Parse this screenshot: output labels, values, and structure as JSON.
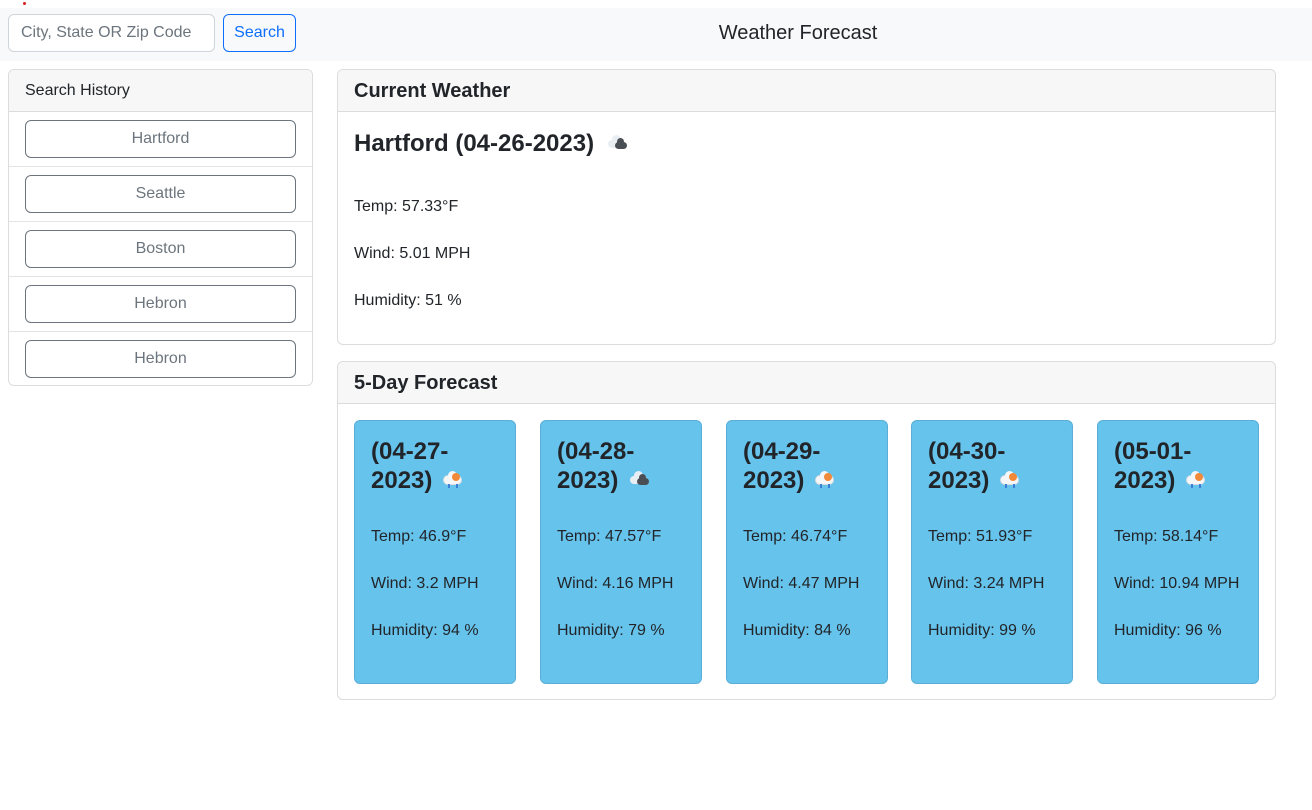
{
  "search": {
    "placeholder": "City, State OR Zip Code",
    "button_label": "Search"
  },
  "header": {
    "title": "Weather Forecast"
  },
  "history": {
    "title": "Search History",
    "items": [
      {
        "label": "Hartford"
      },
      {
        "label": "Seattle"
      },
      {
        "label": "Boston"
      },
      {
        "label": "Hebron"
      },
      {
        "label": "Hebron"
      }
    ]
  },
  "current": {
    "title": "Current Weather",
    "city_date": "Hartford (04-26-2023)",
    "icon": "broken-clouds-icon",
    "temp": "Temp: 57.33°F",
    "wind": "Wind: 5.01 MPH",
    "humidity": "Humidity: 51 %"
  },
  "forecast": {
    "title": "5-Day Forecast",
    "card_color": "#66c3ec",
    "days": [
      {
        "date": "(04-27-2023)",
        "icon": "rain-icon",
        "temp": "Temp: 46.9°F",
        "wind": "Wind: 3.2 MPH",
        "humidity": "Humidity: 94 %"
      },
      {
        "date": "(04-28-2023)",
        "icon": "broken-clouds-icon",
        "temp": "Temp: 47.57°F",
        "wind": "Wind: 4.16 MPH",
        "humidity": "Humidity: 79 %"
      },
      {
        "date": "(04-29-2023)",
        "icon": "rain-icon",
        "temp": "Temp: 46.74°F",
        "wind": "Wind: 4.47 MPH",
        "humidity": "Humidity: 84 %"
      },
      {
        "date": "(04-30-2023)",
        "icon": "rain-icon",
        "temp": "Temp: 51.93°F",
        "wind": "Wind: 3.24 MPH",
        "humidity": "Humidity: 99 %"
      },
      {
        "date": "(05-01-2023)",
        "icon": "rain-icon",
        "temp": "Temp: 58.14°F",
        "wind": "Wind: 10.94 MPH",
        "humidity": "Humidity: 96 %"
      }
    ]
  }
}
